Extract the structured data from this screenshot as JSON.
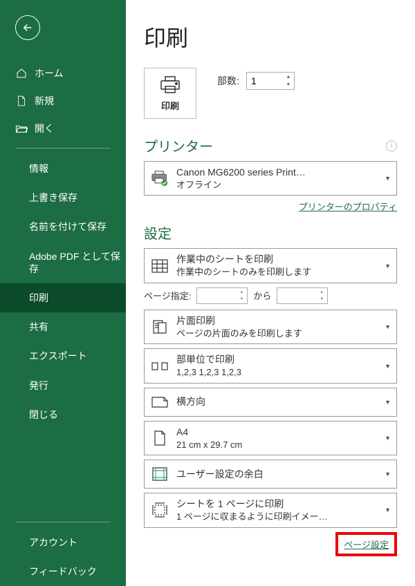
{
  "sidebar": {
    "nav": {
      "home": "ホーム",
      "new": "新規",
      "open": "開く"
    },
    "sub": {
      "info": "情報",
      "overwrite": "上書き保存",
      "saveas": "名前を付けて保存",
      "adobe": "Adobe PDF として保存",
      "print": "印刷",
      "share": "共有",
      "export": "エクスポート",
      "publish": "発行",
      "close": "閉じる",
      "account": "アカウント",
      "feedback": "フィードバック"
    }
  },
  "main": {
    "title": "印刷",
    "copies_label": "部数:",
    "copies_value": "1",
    "print_button": "印刷",
    "printer_header": "プリンター",
    "printer_name": "Canon MG6200 series Print…",
    "printer_status": "オフライン",
    "printer_properties": "プリンターのプロパティ",
    "settings_header": "設定",
    "pages_label": "ページ指定:",
    "pages_from": "",
    "pages_sep": "から",
    "pages_to": "",
    "drop": {
      "sheets_t1": "作業中のシートを印刷",
      "sheets_t2": "作業中のシートのみを印刷します",
      "side_t1": "片面印刷",
      "side_t2": "ページの片面のみを印刷します",
      "collate_t1": "部単位で印刷",
      "collate_t2": "1,2,3    1,2,3    1,2,3",
      "orient_t1": "横方向",
      "paper_t1": "A4",
      "paper_t2": "21 cm x 29.7 cm",
      "margin_t1": "ユーザー設定の余白",
      "fit_t1": "シートを 1 ページに印刷",
      "fit_t2": "1 ページに収まるように印刷イメー…"
    },
    "page_setup": "ページ設定"
  }
}
